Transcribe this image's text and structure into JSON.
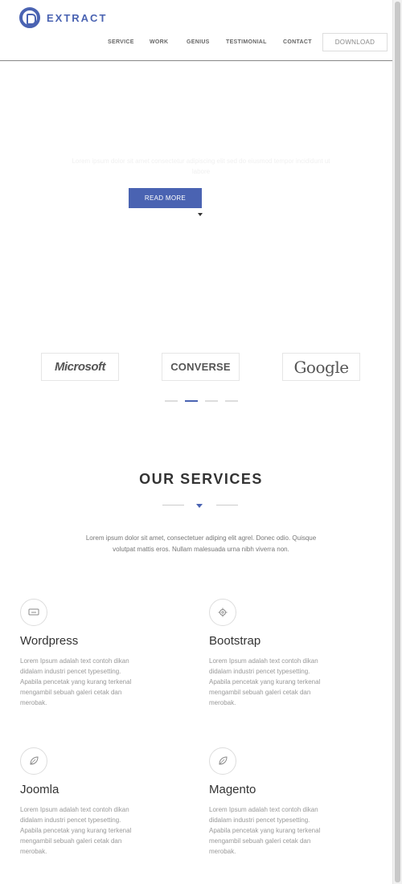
{
  "header": {
    "logo_text": "EXTRACT",
    "nav": [
      "SERVICE",
      "WORK",
      "GENIUS",
      "TESTIMONIAL",
      "CONTACT"
    ],
    "download_label": "DOWNLOAD"
  },
  "hero": {
    "text": "Lorem ipsum dolor sit amet consectetur adipiscing elit sed do eiusmod tempor incididunt ut labore",
    "button_label": "READ MORE"
  },
  "clients": {
    "logos": [
      "Microsoft",
      "CONVERSE",
      "Google"
    ],
    "active_page": 2
  },
  "services": {
    "title": "OUR SERVICES",
    "description": "Lorem ipsum dolor sit amet, consectetuer adiping elit agrel. Donec odio. Quisque volutpat mattis eros. Nullam malesuada urna nibh viverra non.",
    "items": [
      {
        "name": "Wordpress",
        "icon": "monitor-icon",
        "text": "Lorem Ipsum adalah text contoh dikan didalam industri pencet typesetting. Apabila pencetak yang kurang terkenal mengambil sebuah galeri cetak dan merobak."
      },
      {
        "name": "Bootstrap",
        "icon": "gear-icon",
        "text": "Lorem Ipsum adalah text contoh dikan didalam industri pencet typesetting. Apabila pencetak yang kurang terkenal mengambil sebuah galeri cetak dan merobak."
      },
      {
        "name": "Joomla",
        "icon": "leaf-icon",
        "text": "Lorem Ipsum adalah text contoh dikan didalam industri pencet typesetting. Apabila pencetak yang kurang terkenal mengambil sebuah galeri cetak dan merobak."
      },
      {
        "name": "Magento",
        "icon": "leaf-icon",
        "text": "Lorem Ipsum adalah text contoh dikan didalam industri pencet typesetting. Apabila pencetak yang kurang terkenal mengambil sebuah galeri cetak dan merobak."
      }
    ]
  },
  "colors": {
    "accent": "#4a63b2"
  }
}
